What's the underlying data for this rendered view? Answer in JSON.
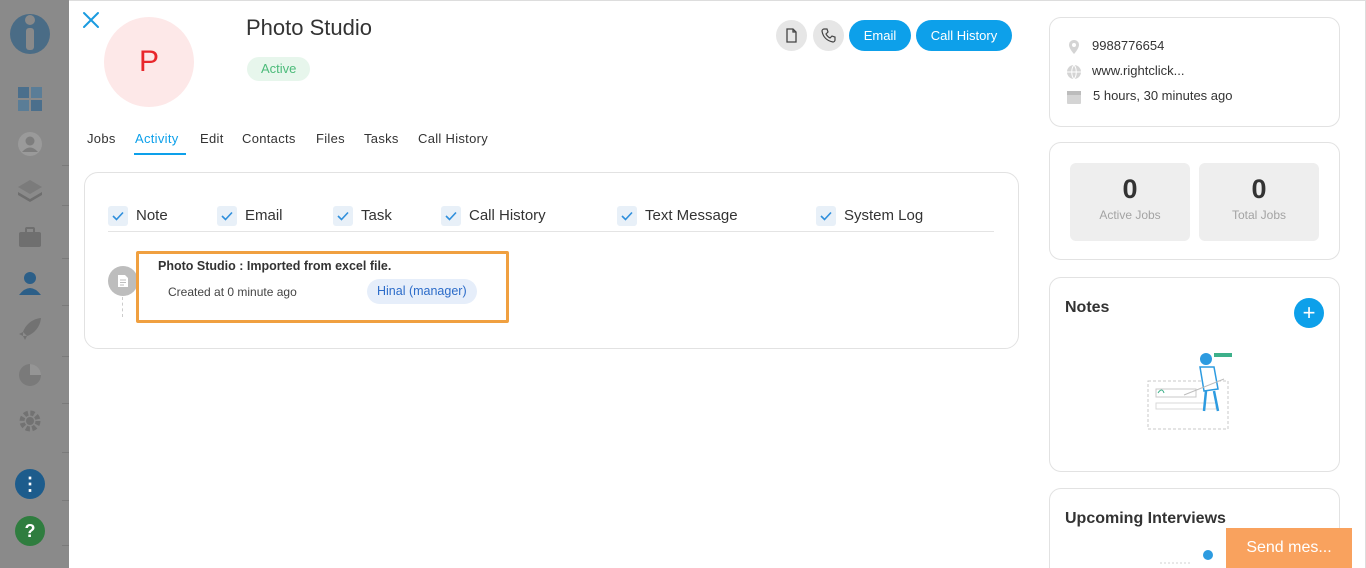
{
  "company": {
    "avatar_letter": "P",
    "name": "Photo Studio",
    "status": "Active"
  },
  "header_actions": {
    "email_label": "Email",
    "call_history_label": "Call History"
  },
  "tabs": [
    {
      "label": "Jobs",
      "active": false
    },
    {
      "label": "Activity",
      "active": true
    },
    {
      "label": "Edit",
      "active": false
    },
    {
      "label": "Contacts",
      "active": false
    },
    {
      "label": "Files",
      "active": false
    },
    {
      "label": "Tasks",
      "active": false
    },
    {
      "label": "Call History",
      "active": false
    }
  ],
  "filters": [
    {
      "label": "Note",
      "checked": true
    },
    {
      "label": "Email",
      "checked": true
    },
    {
      "label": "Task",
      "checked": true
    },
    {
      "label": "Call History",
      "checked": true
    },
    {
      "label": "Text Message",
      "checked": true
    },
    {
      "label": "System Log",
      "checked": true
    }
  ],
  "activity": [
    {
      "title": "Photo Studio : Imported from excel file.",
      "created": "Created at 0 minute ago",
      "user": "Hinal (manager)"
    }
  ],
  "info": {
    "phone": "9988776654",
    "website": "www.rightclick...",
    "time": "5 hours, 30 minutes ago"
  },
  "stats": [
    {
      "value": "0",
      "label": "Active Jobs"
    },
    {
      "value": "0",
      "label": "Total Jobs"
    }
  ],
  "notes": {
    "title": "Notes"
  },
  "upcoming": {
    "title": "Upcoming Interviews"
  },
  "chat": {
    "send_label": "Send mes..."
  },
  "colors": {
    "accent": "#0da0ea",
    "status_green": "#4cbb7a",
    "highlight": "#f0a040",
    "avatar_red": "#e8262b"
  }
}
